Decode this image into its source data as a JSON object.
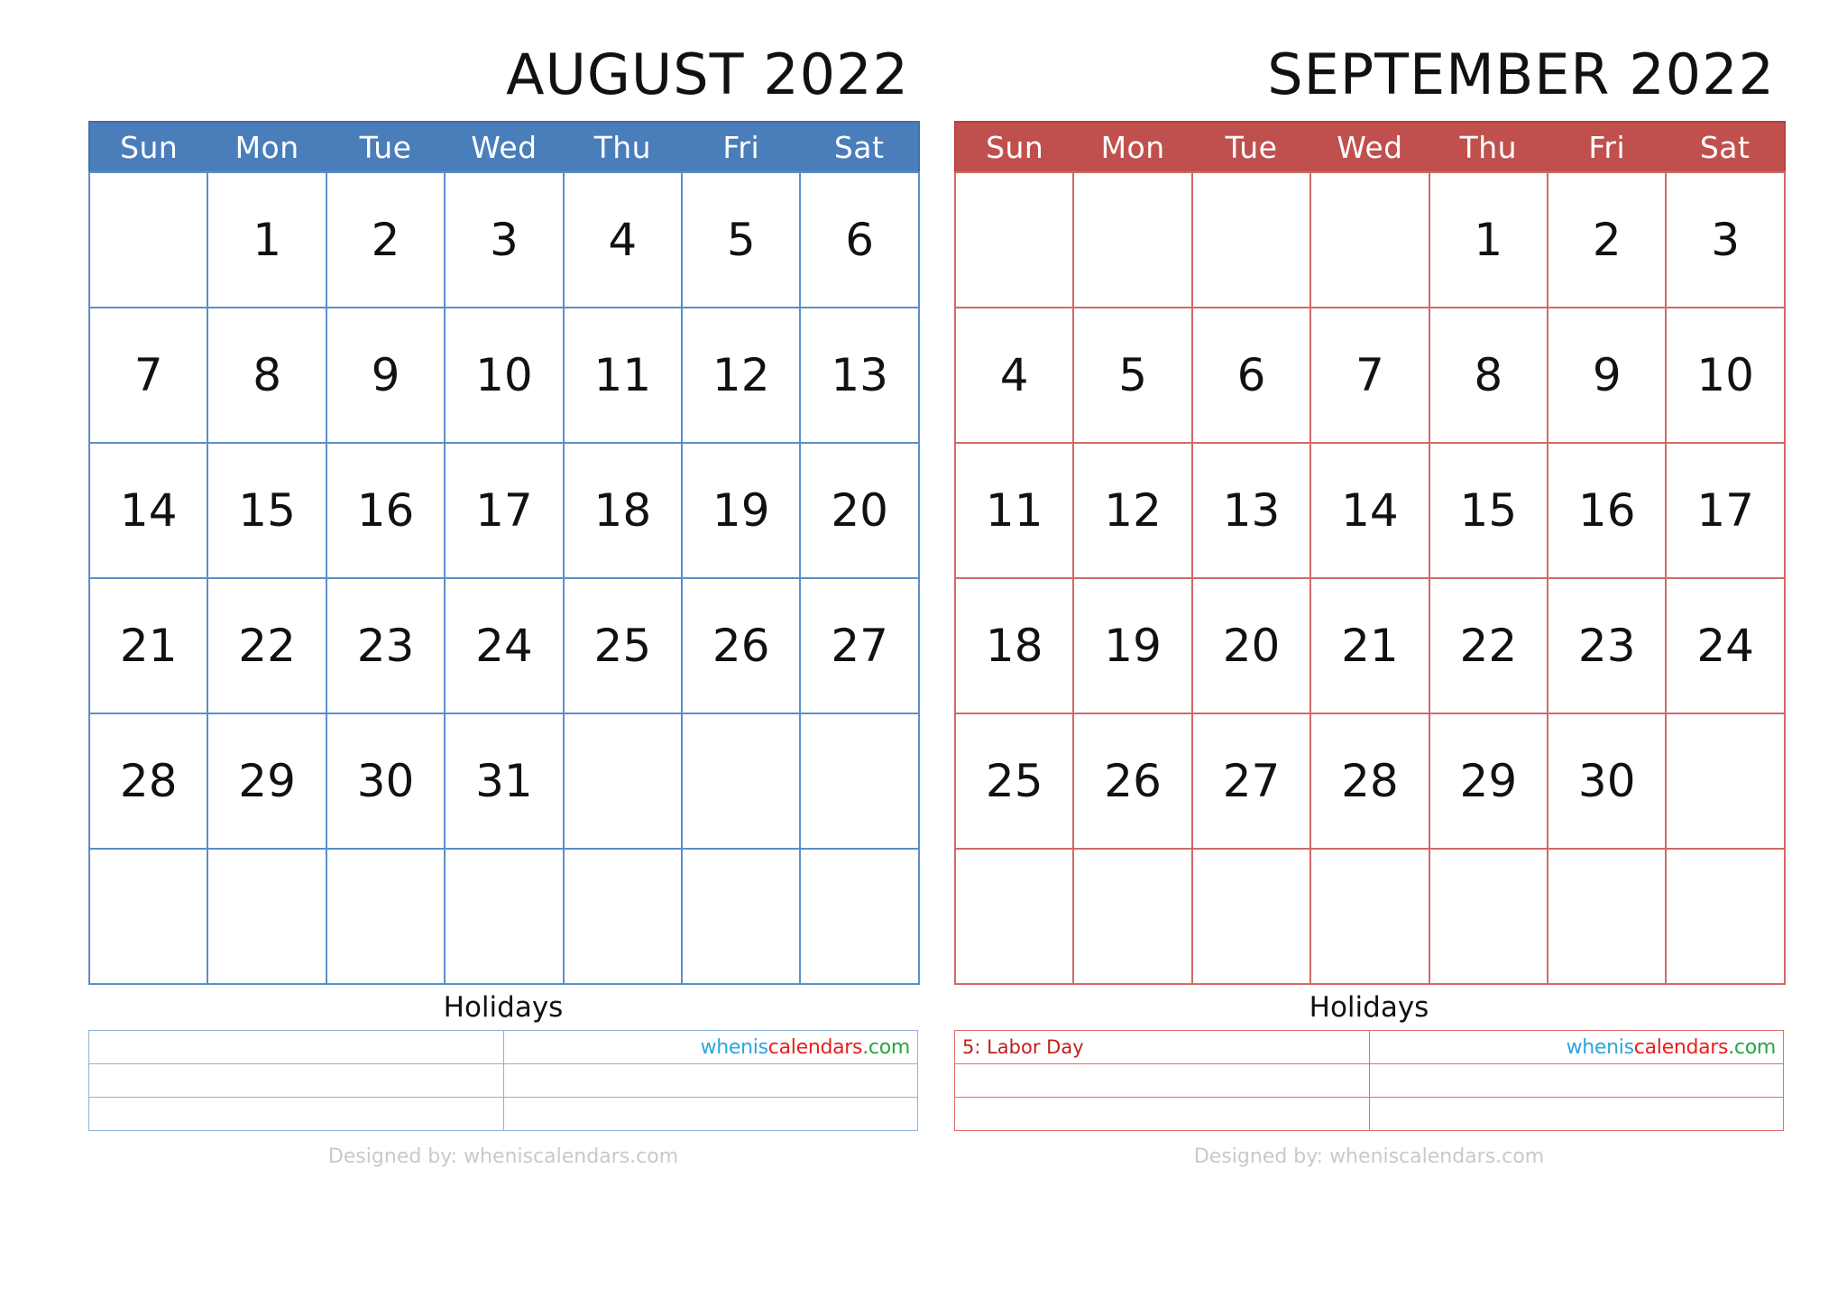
{
  "theme": {
    "august_header_bg": "#4a7ebb",
    "august_grid_line": "#5b8fc9",
    "september_header_bg": "#c0504d",
    "september_grid_line": "#cf6a67",
    "sunday_color": "#c00000",
    "saturday_color": "#1f7ac0",
    "weekday_color": "#111111",
    "designed_color": "#c9c9c9"
  },
  "logo": {
    "part1": "whenis",
    "part2": "calendars",
    "part3": ".com"
  },
  "footer": {
    "designed_by": "Designed by: wheniscalendars.com"
  },
  "months": [
    {
      "id": "august",
      "title": "AUGUST 2022",
      "weekdays": [
        "Sun",
        "Mon",
        "Tue",
        "Wed",
        "Thu",
        "Fri",
        "Sat"
      ],
      "holidays_label": "Holidays",
      "holiday_rows": [
        [
          "",
          ""
        ],
        [
          "",
          ""
        ],
        [
          "",
          ""
        ]
      ],
      "weeks": [
        [
          "",
          "1",
          "2",
          "3",
          "4",
          "5",
          "6"
        ],
        [
          "7",
          "8",
          "9",
          "10",
          "11",
          "12",
          "13"
        ],
        [
          "14",
          "15",
          "16",
          "17",
          "18",
          "19",
          "20"
        ],
        [
          "21",
          "22",
          "23",
          "24",
          "25",
          "26",
          "27"
        ],
        [
          "28",
          "29",
          "30",
          "31",
          "",
          "",
          ""
        ],
        [
          "",
          "",
          "",
          "",
          "",
          "",
          ""
        ]
      ],
      "highlight_red": []
    },
    {
      "id": "september",
      "title": "SEPTEMBER 2022",
      "weekdays": [
        "Sun",
        "Mon",
        "Tue",
        "Wed",
        "Thu",
        "Fri",
        "Sat"
      ],
      "holidays_label": "Holidays",
      "holiday_rows": [
        [
          "5: Labor Day",
          ""
        ],
        [
          "",
          ""
        ],
        [
          "",
          ""
        ]
      ],
      "weeks": [
        [
          "",
          "",
          "",
          "",
          "1",
          "2",
          "3"
        ],
        [
          "4",
          "5",
          "6",
          "7",
          "8",
          "9",
          "10"
        ],
        [
          "11",
          "12",
          "13",
          "14",
          "15",
          "16",
          "17"
        ],
        [
          "18",
          "19",
          "20",
          "21",
          "22",
          "23",
          "24"
        ],
        [
          "25",
          "26",
          "27",
          "28",
          "29",
          "30",
          ""
        ],
        [
          "",
          "",
          "",
          "",
          "",
          "",
          ""
        ]
      ],
      "highlight_red": [
        "5"
      ]
    }
  ]
}
